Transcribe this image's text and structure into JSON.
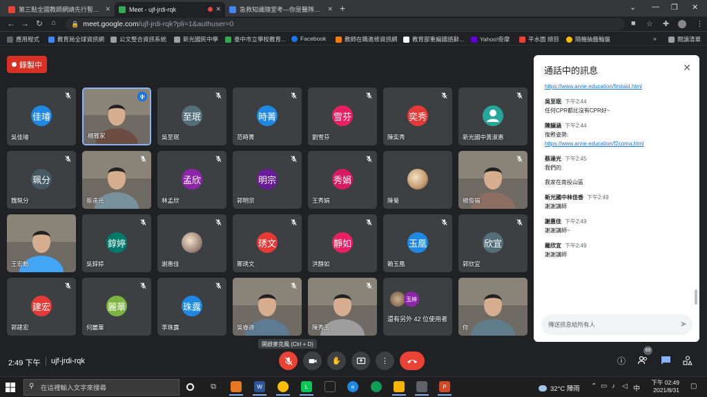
{
  "browser": {
    "tabs": [
      {
        "title": "第三點全國教師網請先行暫停範",
        "fav_color": "#ea4335"
      },
      {
        "title": "Meet - ujf-jrdi-rqk",
        "fav_color": "#34a853"
      },
      {
        "title": "急救知識隨堂考—你是醫隊友還",
        "fav_color": "#4285f4"
      }
    ],
    "url_host": "meet.google.com",
    "url_path": "/ujf-jrdi-rqk?pli=1&authuser=0",
    "bookmarks": [
      {
        "label": "應用程式",
        "color": "#5f6368"
      },
      {
        "label": "教育局全球資訊網",
        "color": "#4285f4"
      },
      {
        "label": "公文整合資訊系統",
        "color": "#9aa0a6"
      },
      {
        "label": "新光國民中學",
        "color": "#9aa0a6"
      },
      {
        "label": "臺中市立學校教育...",
        "color": "#34a853"
      },
      {
        "label": "Facebook",
        "color": "#1877f2"
      },
      {
        "label": "教師在職進修資訊網",
        "color": "#f57c00"
      },
      {
        "label": "教育部重編國語辭...",
        "color": "#ffffff"
      },
      {
        "label": "Yahoo!奇摩",
        "color": "#6001d2"
      },
      {
        "label": "平水圖 總目",
        "color": "#ea4335"
      },
      {
        "label": "隨機抽籤輪盤",
        "color": "#fbbc04"
      }
    ],
    "reading_list": "閱讀清單"
  },
  "meet": {
    "recording_label": "錄製中",
    "participants": [
      {
        "name": "吳佳璿",
        "avatar": "佳璿",
        "color": "#1e88e5",
        "camera": false
      },
      {
        "name": "楊雅家",
        "avatar": "",
        "color": "#6d4c41",
        "camera": true,
        "speaking": true
      },
      {
        "name": "吳至珉",
        "avatar": "至珉",
        "color": "#546e7a",
        "camera": false
      },
      {
        "name": "范時菁",
        "avatar": "時菁",
        "color": "#1e88e5",
        "camera": false
      },
      {
        "name": "劉雪芬",
        "avatar": "雪芬",
        "color": "#e91e63",
        "camera": false
      },
      {
        "name": "陳奕秀",
        "avatar": "奕秀",
        "color": "#e53935",
        "camera": false
      },
      {
        "name": "新光國中黃淑惠",
        "avatar": "person",
        "color": "#26a69a",
        "camera": false
      },
      {
        "name": "魏珮分",
        "avatar": "珮分",
        "color": "#455a64",
        "camera": false
      },
      {
        "name": "蔡達光",
        "avatar": "",
        "color": "#78909c",
        "camera": true
      },
      {
        "name": "林孟欣",
        "avatar": "孟欣",
        "color": "#8e24aa",
        "camera": false
      },
      {
        "name": "郭明宗",
        "avatar": "明宗",
        "color": "#6a1b9a",
        "camera": false
      },
      {
        "name": "王秀娟",
        "avatar": "秀娟",
        "color": "#d81b60",
        "camera": false
      },
      {
        "name": "陳菊",
        "avatar": "photo",
        "color": "#c49a6c",
        "camera": false
      },
      {
        "name": "楊俊福",
        "avatar": "",
        "color": "#8d6e63",
        "camera": true
      },
      {
        "name": "王宏勳",
        "avatar": "",
        "color": "#42a5f5",
        "camera": true
      },
      {
        "name": "吳錞婷",
        "avatar": "錞婷",
        "color": "#00796b",
        "camera": false
      },
      {
        "name": "謝惠佳",
        "avatar": "photo",
        "color": "#a1887f",
        "camera": false
      },
      {
        "name": "鄭琇文",
        "avatar": "琇文",
        "color": "#e53935",
        "camera": false
      },
      {
        "name": "洪靜如",
        "avatar": "靜如",
        "color": "#e91e63",
        "camera": false
      },
      {
        "name": "賴玉凰",
        "avatar": "玉凰",
        "color": "#1e88e5",
        "camera": false
      },
      {
        "name": "郭欣宜",
        "avatar": "欣宜",
        "color": "#546e7a",
        "camera": false
      },
      {
        "name": "郭建宏",
        "avatar": "建宏",
        "color": "#e53935",
        "camera": false
      },
      {
        "name": "何麗華",
        "avatar": "麗華",
        "color": "#7cb342",
        "camera": false
      },
      {
        "name": "李珠露",
        "avatar": "珠露",
        "color": "#1e88e5",
        "camera": false
      },
      {
        "name": "吳睿迪",
        "avatar": "",
        "color": "#5d7b92",
        "camera": true
      },
      {
        "name": "陳秀玉",
        "avatar": "",
        "color": "#9e9e9e",
        "camera": true
      },
      {
        "name": "還有另外 42 位使用者",
        "avatar": "玉婷",
        "color": "#8e24aa",
        "camera": false,
        "others": true
      },
      {
        "name": "你",
        "avatar": "",
        "color": "#607d8b",
        "camera": true
      }
    ],
    "tooltip": "開啟麥克風 (Ctrl + D)",
    "time": "2:49 下午",
    "meeting_code": "ujf-jrdi-rqk",
    "people_count": "69"
  },
  "chat": {
    "title": "通話中的訊息",
    "messages": [
      {
        "sender": "",
        "time": "",
        "lines": [],
        "link": "https://www.anne.education/firstaid.html"
      },
      {
        "sender": "吳至珉",
        "time": "下午2:44",
        "lines": [
          "任何CPR都比沒有CPR好~"
        ],
        "link": ""
      },
      {
        "sender": "陳韻涵",
        "time": "下午2:44",
        "lines": [
          "復甦姿勢:"
        ],
        "link": "https://www.anne.education/f2coma.html"
      },
      {
        "sender": "蔡達光",
        "time": "下午2:45",
        "lines": [
          "我們的",
          "我家在南投山區"
        ],
        "link": ""
      },
      {
        "sender": "新光國中林佳香",
        "time": "下午2:49",
        "lines": [
          "謝謝講師"
        ],
        "link": ""
      },
      {
        "sender": "謝惠佳",
        "time": "下午2:49",
        "lines": [
          "謝謝講師~"
        ],
        "link": ""
      },
      {
        "sender": "羅欣宜",
        "time": "下午2:49",
        "lines": [
          "謝謝講師"
        ],
        "link": ""
      }
    ],
    "placeholder": "傳送訊息給所有人"
  },
  "taskbar": {
    "search_placeholder": "在這裡輸入文字來搜尋",
    "weather": "32°C 陣雨",
    "ime": "中",
    "time": "下午 02:49",
    "date": "2021/8/31"
  }
}
